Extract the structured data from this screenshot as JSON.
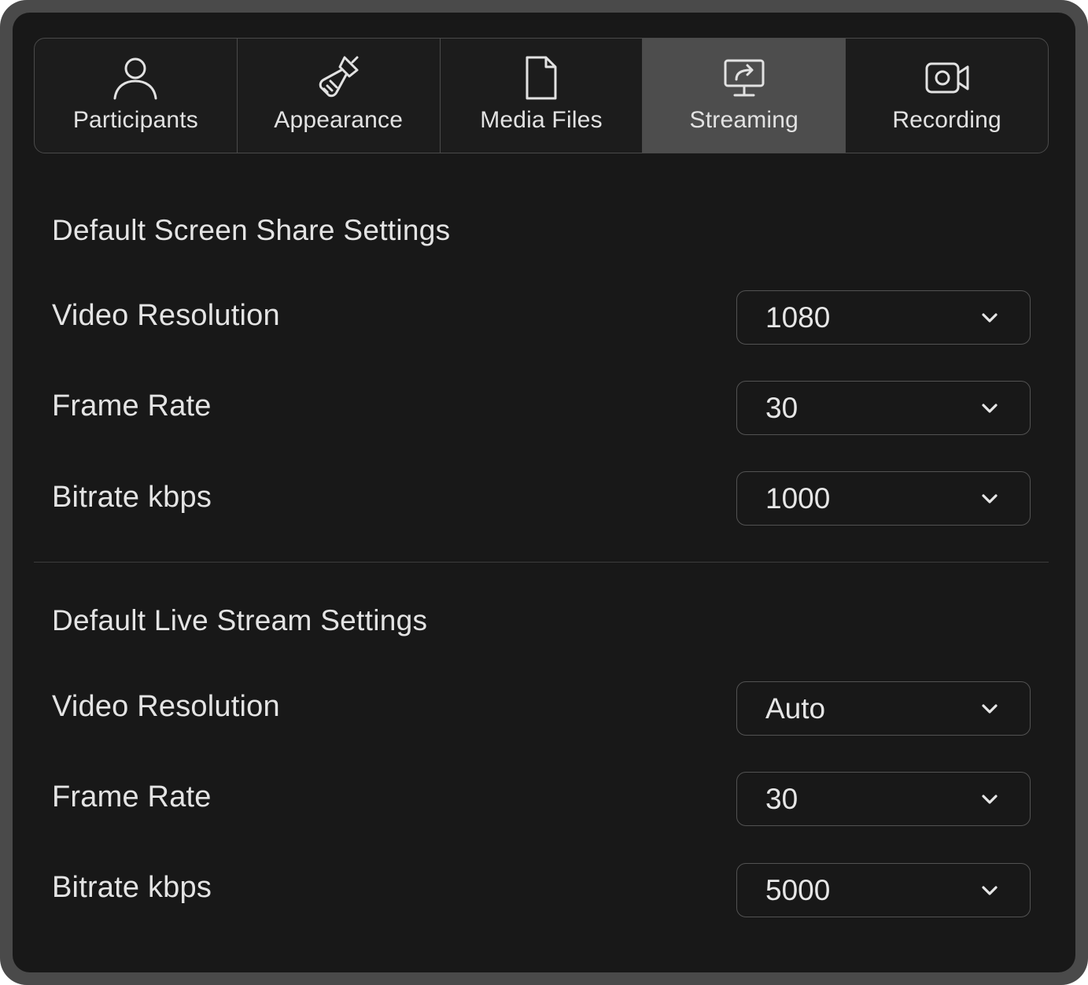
{
  "tabs": [
    {
      "label": "Participants",
      "icon": "person-icon",
      "active": false
    },
    {
      "label": "Appearance",
      "icon": "brush-icon",
      "active": false
    },
    {
      "label": "Media Files",
      "icon": "file-icon",
      "active": false
    },
    {
      "label": "Streaming",
      "icon": "screen-share-icon",
      "active": true
    },
    {
      "label": "Recording",
      "icon": "video-camera-icon",
      "active": false
    }
  ],
  "screen_share": {
    "title": "Default Screen Share Settings",
    "video_resolution": {
      "label": "Video Resolution",
      "value": "1080"
    },
    "frame_rate": {
      "label": "Frame Rate",
      "value": "30"
    },
    "bitrate": {
      "label": "Bitrate kbps",
      "value": "1000"
    }
  },
  "live_stream": {
    "title": "Default Live Stream Settings",
    "video_resolution": {
      "label": "Video Resolution",
      "value": "Auto"
    },
    "frame_rate": {
      "label": "Frame Rate",
      "value": "30"
    },
    "bitrate": {
      "label": "Bitrate kbps",
      "value": "5000"
    }
  },
  "colors": {
    "background": "#181818",
    "active_tab": "#4d4d4d",
    "border": "#4a4a4a",
    "text": "#e4e4e4"
  }
}
